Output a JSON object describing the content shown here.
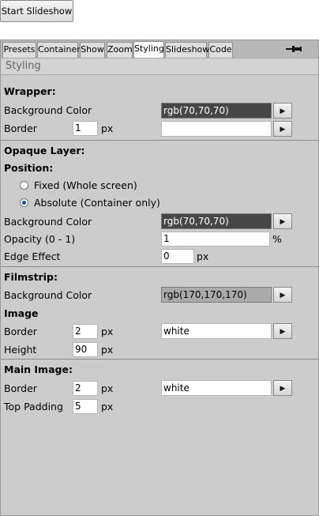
{
  "start_button": "Start Slideshow",
  "tabs": [
    "Presets",
    "Container",
    "Show",
    "Zoom",
    "Styling",
    "Slideshow",
    "Code"
  ],
  "active_tab": "Styling",
  "heading": "Styling",
  "wrapper": {
    "title": "Wrapper:",
    "bg_label": "Background Color",
    "bg_value": "rgb(70,70,70)",
    "border_label": "Border",
    "border_value": "1",
    "border_unit": "px",
    "border_color": ""
  },
  "opaque": {
    "title": "Opaque Layer:",
    "position_label": "Position:",
    "fixed_label": "Fixed (Whole screen)",
    "absolute_label": "Absolute (Container only)",
    "selected_position": "absolute",
    "bg_label": "Background Color",
    "bg_value": "rgb(70,70,70)",
    "opacity_label": "Opacity (0 - 1)",
    "opacity_value": "1",
    "opacity_unit": "%",
    "edge_label": "Edge Effect",
    "edge_value": "0",
    "edge_unit": "px"
  },
  "filmstrip": {
    "title": "Filmstrip:",
    "bg_label": "Background Color",
    "bg_value": "rgb(170,170,170)",
    "image_title": "Image",
    "border_label": "Border",
    "border_value": "2",
    "border_unit": "px",
    "border_color": "white",
    "height_label": "Height",
    "height_value": "90",
    "height_unit": "px"
  },
  "main_image": {
    "title": "Main Image:",
    "border_label": "Border",
    "border_value": "2",
    "border_unit": "px",
    "border_color": "white",
    "padding_label": "Top Padding",
    "padding_value": "5",
    "padding_unit": "px"
  },
  "picker_symbol": "▶",
  "colors": {
    "panel_bg": "#cccccc",
    "dark_swatch": "#464646",
    "light_swatch": "#aaaaaa"
  }
}
